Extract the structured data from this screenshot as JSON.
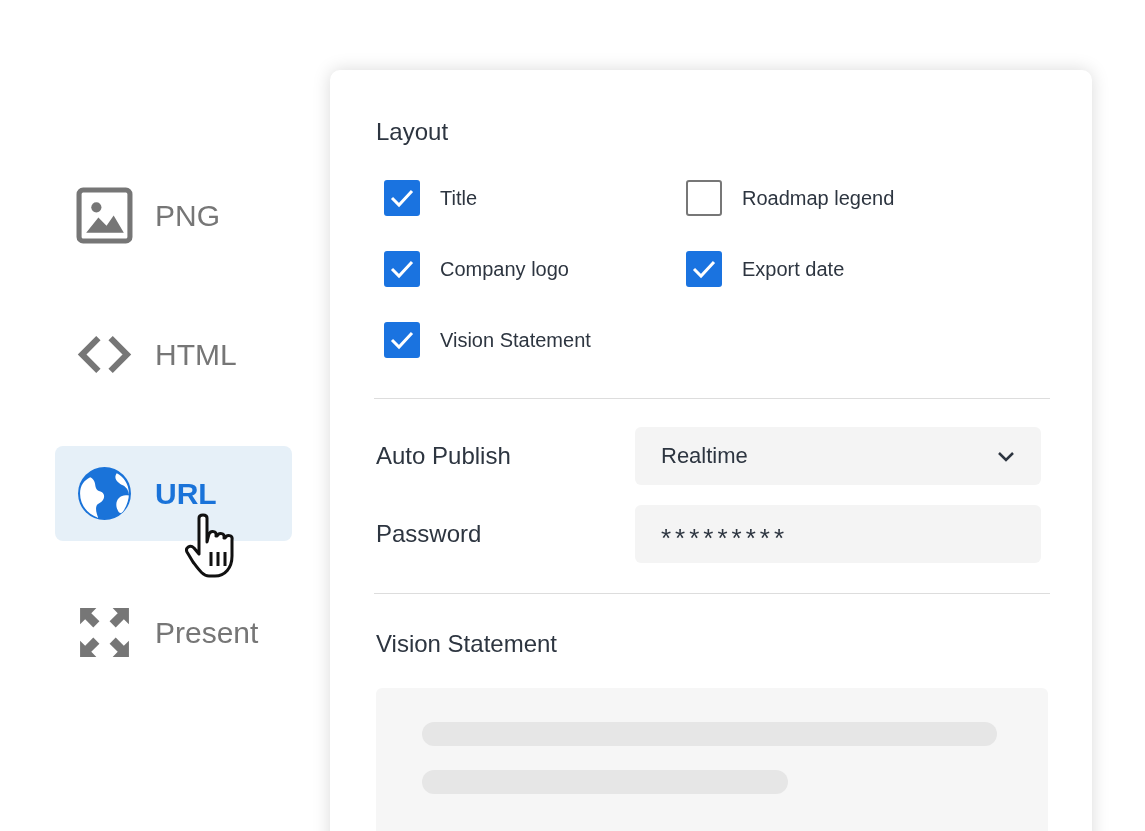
{
  "export_options": [
    {
      "kind": "image",
      "label": "PNG",
      "selected": false
    },
    {
      "kind": "code",
      "label": "HTML",
      "selected": false
    },
    {
      "kind": "globe",
      "label": "URL",
      "selected": true
    },
    {
      "kind": "expand",
      "label": "Present",
      "selected": false
    }
  ],
  "panel": {
    "layout": {
      "title": "Layout",
      "options": [
        {
          "label": "Title",
          "checked": true
        },
        {
          "label": "Roadmap legend",
          "checked": false
        },
        {
          "label": "Company logo",
          "checked": true
        },
        {
          "label": "Export date",
          "checked": true
        },
        {
          "label": "Vision Statement",
          "checked": true
        }
      ]
    },
    "auto_publish": {
      "label": "Auto Publish",
      "value": "Realtime"
    },
    "password": {
      "label": "Password",
      "value": "*********"
    },
    "vision_statement": {
      "title": "Vision Statement"
    }
  }
}
